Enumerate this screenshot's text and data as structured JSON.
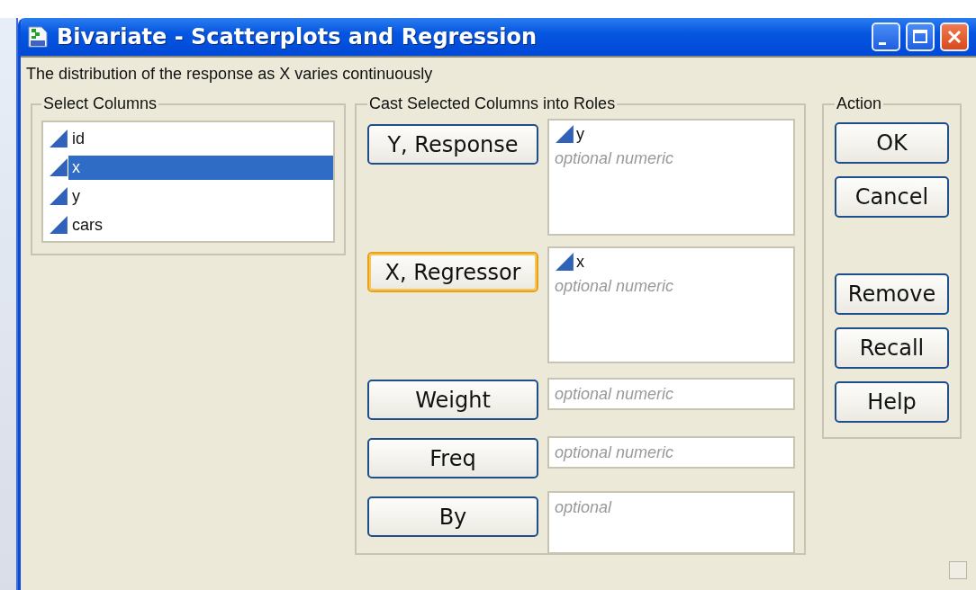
{
  "window": {
    "title": "Bivariate - Scatterplots and Regression"
  },
  "description": "The distribution of the response as X varies continuously",
  "select_columns": {
    "title": "Select Columns",
    "items": [
      {
        "label": "id",
        "selected": false
      },
      {
        "label": "x",
        "selected": true
      },
      {
        "label": "y",
        "selected": false
      },
      {
        "label": "cars",
        "selected": false
      }
    ]
  },
  "roles": {
    "title": "Cast Selected Columns into Roles",
    "rows": [
      {
        "button": "Y, Response",
        "focused": false,
        "kind": "tall",
        "columns": [
          "y"
        ],
        "placeholder": "optional numeric"
      },
      {
        "button": "X, Regressor",
        "focused": true,
        "kind": "tall",
        "columns": [
          "x"
        ],
        "placeholder": "optional numeric"
      },
      {
        "button": "Weight",
        "focused": false,
        "kind": "single",
        "columns": [],
        "placeholder": "optional numeric"
      },
      {
        "button": "Freq",
        "focused": false,
        "kind": "single",
        "columns": [],
        "placeholder": "optional numeric"
      },
      {
        "button": "By",
        "focused": false,
        "kind": "medium",
        "columns": [],
        "placeholder": "optional"
      }
    ]
  },
  "action": {
    "title": "Action",
    "buttons": [
      {
        "label": "OK"
      },
      {
        "label": "Cancel"
      },
      {
        "label": "Remove"
      },
      {
        "label": "Recall"
      },
      {
        "label": "Help"
      }
    ]
  }
}
